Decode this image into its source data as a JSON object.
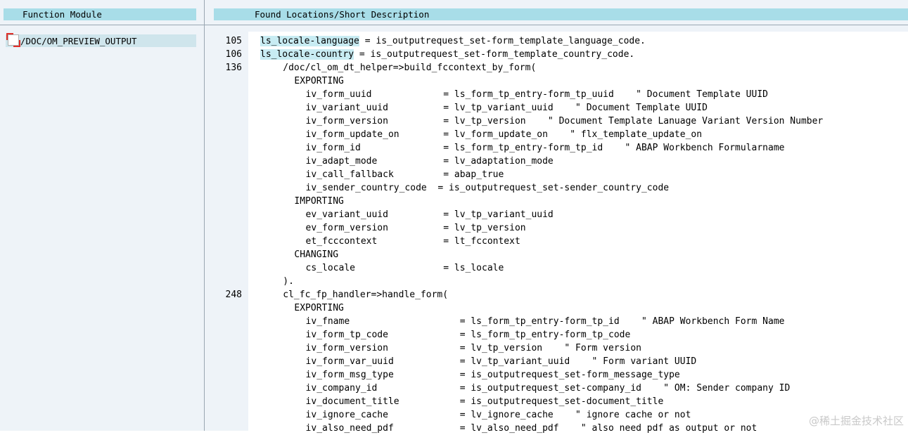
{
  "left_panel": {
    "header": "Function Module",
    "module": "/DOC/OM_PREVIEW_OUTPUT"
  },
  "right_panel": {
    "header": "Found Locations/Short Description"
  },
  "code_lines": [
    {
      "no": "105",
      "indent": 0,
      "hl": "ls_locale-language",
      "text": " = is_outputrequest_set-form_template_language_code."
    },
    {
      "no": "106",
      "indent": 0,
      "hl": "ls_locale-country",
      "text": " = is_outputrequest_set-form_template_country_code."
    },
    {
      "no": "136",
      "indent": 4,
      "text": "/doc/cl_om_dt_helper=>build_fccontext_by_form("
    },
    {
      "no": "",
      "indent": 6,
      "text": "EXPORTING"
    },
    {
      "no": "",
      "indent": 8,
      "text": "iv_form_uuid             = ls_form_tp_entry-form_tp_uuid    \" Document Template UUID"
    },
    {
      "no": "",
      "indent": 8,
      "text": "iv_variant_uuid          = lv_tp_variant_uuid    \" Document Template UUID"
    },
    {
      "no": "",
      "indent": 8,
      "text": "iv_form_version          = lv_tp_version    \" Document Template Lanuage Variant Version Number"
    },
    {
      "no": "",
      "indent": 8,
      "text": "iv_form_update_on        = lv_form_update_on    \" flx_template_update_on"
    },
    {
      "no": "",
      "indent": 8,
      "text": "iv_form_id               = ls_form_tp_entry-form_tp_id    \" ABAP Workbench Formularname"
    },
    {
      "no": "",
      "indent": 8,
      "text": "iv_adapt_mode            = lv_adaptation_mode"
    },
    {
      "no": "",
      "indent": 8,
      "text": "iv_call_fallback         = abap_true"
    },
    {
      "no": "",
      "indent": 8,
      "text": "iv_sender_country_code  = is_outputrequest_set-sender_country_code"
    },
    {
      "no": "",
      "indent": 6,
      "text": "IMPORTING"
    },
    {
      "no": "",
      "indent": 8,
      "text": "ev_variant_uuid          = lv_tp_variant_uuid"
    },
    {
      "no": "",
      "indent": 8,
      "text": "ev_form_version          = lv_tp_version"
    },
    {
      "no": "",
      "indent": 8,
      "text": "et_fcccontext            = lt_fccontext"
    },
    {
      "no": "",
      "indent": 6,
      "text": "CHANGING"
    },
    {
      "no": "",
      "indent": 8,
      "text": "cs_locale                = ls_locale"
    },
    {
      "no": "",
      "indent": 4,
      "text": ")."
    },
    {
      "no": "248",
      "indent": 4,
      "text": "cl_fc_fp_handler=>handle_form("
    },
    {
      "no": "",
      "indent": 6,
      "text": "EXPORTING"
    },
    {
      "no": "",
      "indent": 8,
      "text": "iv_fname                    = ls_form_tp_entry-form_tp_id    \" ABAP Workbench Form Name"
    },
    {
      "no": "",
      "indent": 8,
      "text": "iv_form_tp_code             = ls_form_tp_entry-form_tp_code"
    },
    {
      "no": "",
      "indent": 8,
      "text": "iv_form_version             = lv_tp_version    \" Form version"
    },
    {
      "no": "",
      "indent": 8,
      "text": "iv_form_var_uuid            = lv_tp_variant_uuid    \" Form variant UUID"
    },
    {
      "no": "",
      "indent": 8,
      "text": "iv_form_msg_type            = is_outputrequest_set-form_message_type"
    },
    {
      "no": "",
      "indent": 8,
      "text": "iv_company_id               = is_outputrequest_set-company_id    \" OM: Sender company ID"
    },
    {
      "no": "",
      "indent": 8,
      "text": "iv_document_title           = is_outputrequest_set-document_title"
    },
    {
      "no": "",
      "indent": 8,
      "text": "iv_ignore_cache             = lv_ignore_cache    \" ignore cache or not"
    },
    {
      "no": "",
      "indent": 8,
      "text": "iv_also_need_pdf            = lv_also_need_pdf    \" also need pdf as output or not"
    }
  ],
  "watermark": "@稀土掘金技术社区"
}
